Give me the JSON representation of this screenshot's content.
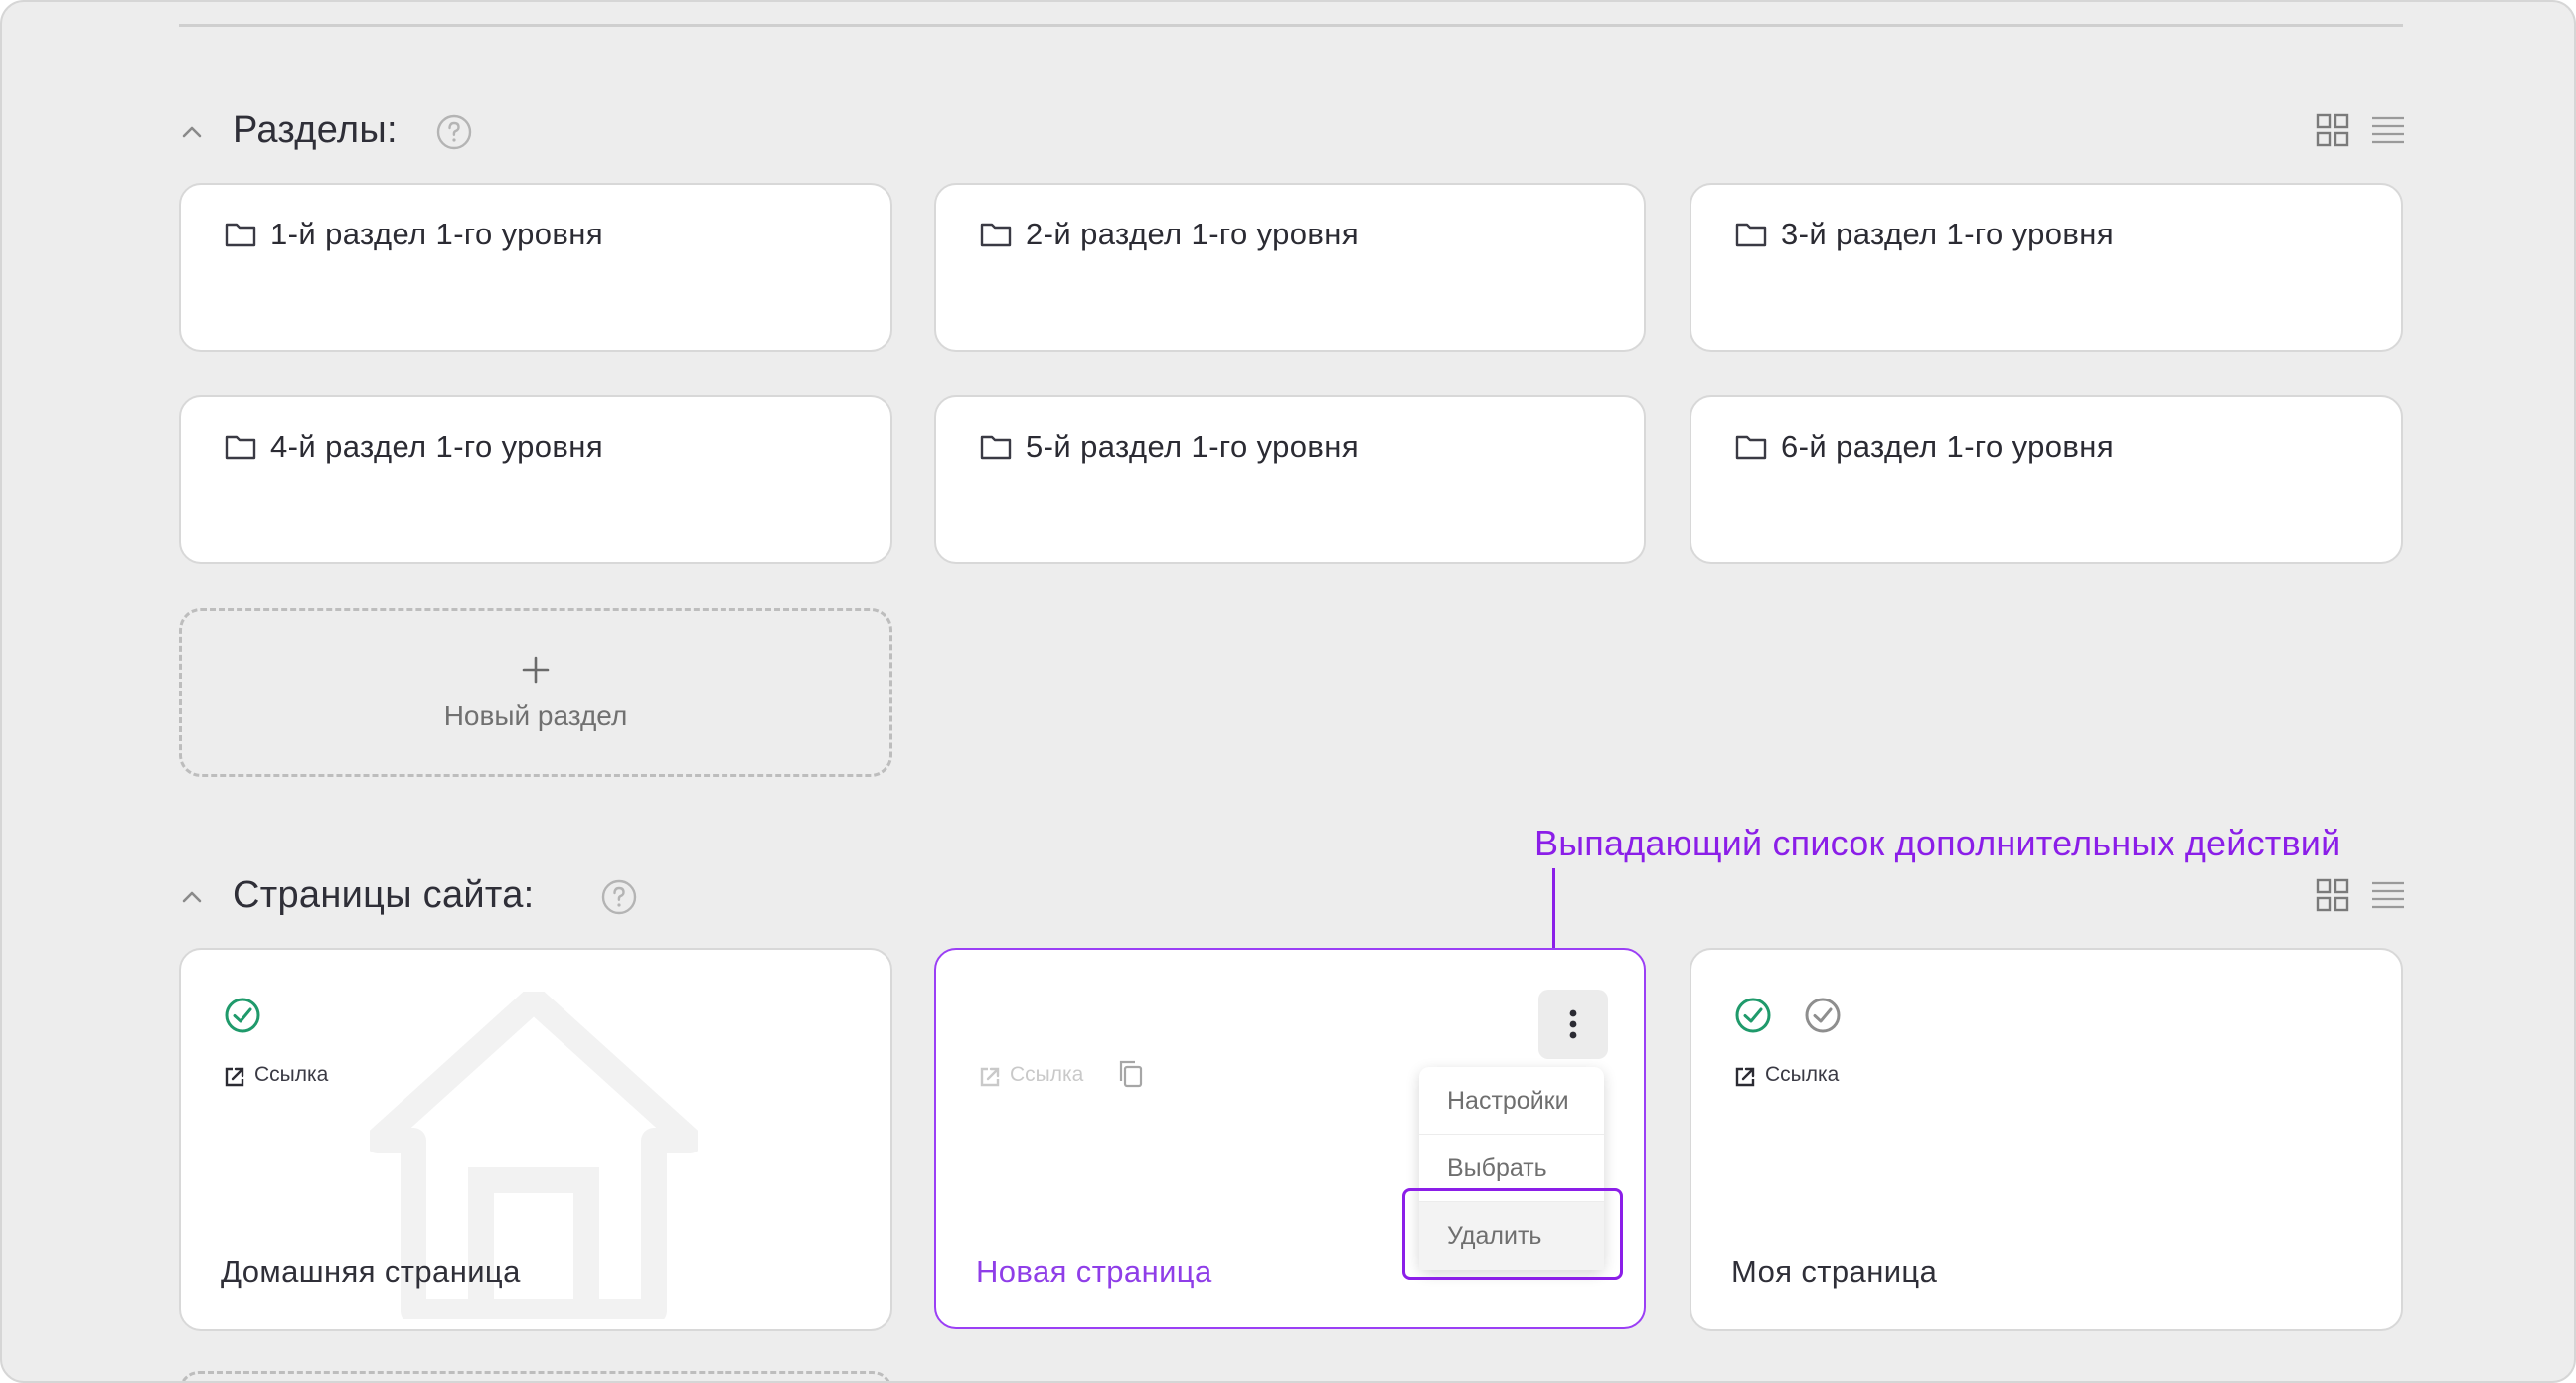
{
  "sections": {
    "title": "Разделы:",
    "items": [
      {
        "label": "1-й раздел 1-го уровня"
      },
      {
        "label": "2-й раздел 1-го уровня"
      },
      {
        "label": "3-й раздел 1-го уровня"
      },
      {
        "label": "4-й раздел 1-го уровня"
      },
      {
        "label": "5-й раздел 1-го уровня"
      },
      {
        "label": "6-й раздел 1-го уровня"
      }
    ],
    "new_label": "Новый раздел"
  },
  "pages": {
    "title": "Страницы сайта:",
    "items": [
      {
        "name": "Домашняя страница",
        "link_label": "Ссылка"
      },
      {
        "name": "Новая страница",
        "link_label": "Ссылка"
      },
      {
        "name": "Моя страница",
        "link_label": "Ссылка"
      }
    ]
  },
  "dropdown": {
    "items": [
      "Настройки",
      "Выбрать",
      "Удалить"
    ]
  },
  "annotation": {
    "text": "Выпадающий список дополнительных действий"
  },
  "colors": {
    "accent": "#8b1ee8",
    "success": "#1f9a6b",
    "background": "#ededed"
  }
}
